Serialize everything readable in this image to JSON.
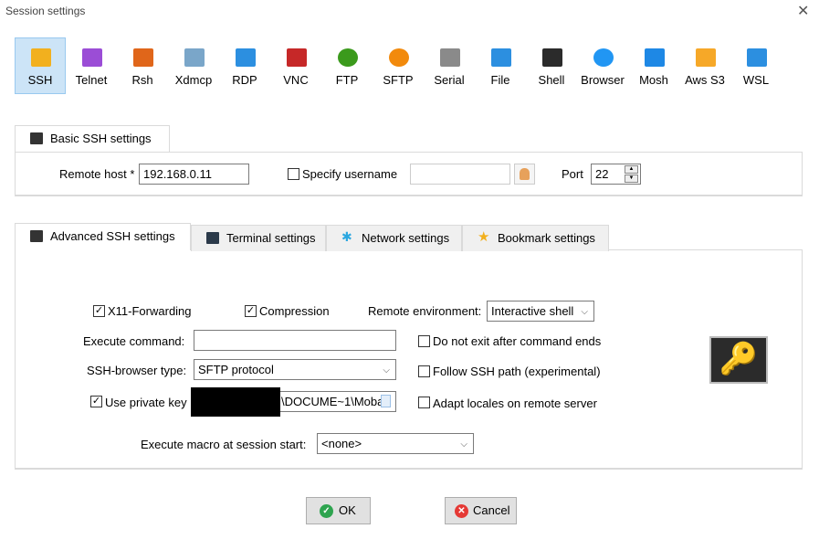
{
  "window": {
    "title": "Session settings",
    "close_icon": "close-icon"
  },
  "session_types": [
    {
      "label": "SSH",
      "icon": "ssh-key-icon",
      "color": "#f2b01e",
      "selected": true
    },
    {
      "label": "Telnet",
      "icon": "telnet-icon",
      "color": "#9b4dd6"
    },
    {
      "label": "Rsh",
      "icon": "rsh-icon",
      "color": "#e0661a"
    },
    {
      "label": "Xdmcp",
      "icon": "xdmcp-icon",
      "color": "#7aa6c9"
    },
    {
      "label": "RDP",
      "icon": "rdp-icon",
      "color": "#2c8fe0"
    },
    {
      "label": "VNC",
      "icon": "vnc-icon",
      "color": "#c62828"
    },
    {
      "label": "FTP",
      "icon": "ftp-globe-icon",
      "color": "#3b9a1c"
    },
    {
      "label": "SFTP",
      "icon": "sftp-globe-icon",
      "color": "#f28a0c"
    },
    {
      "label": "Serial",
      "icon": "serial-plug-icon",
      "color": "#8a8a8a"
    },
    {
      "label": "File",
      "icon": "file-monitor-icon",
      "color": "#2c8fe0"
    },
    {
      "label": "Shell",
      "icon": "shell-terminal-icon",
      "color": "#2b2b2b"
    },
    {
      "label": "Browser",
      "icon": "browser-globe-icon",
      "color": "#2196f3"
    },
    {
      "label": "Mosh",
      "icon": "mosh-satellite-icon",
      "color": "#1e88e5"
    },
    {
      "label": "Aws S3",
      "icon": "aws-s3-icon",
      "color": "#f6a828"
    },
    {
      "label": "WSL",
      "icon": "wsl-windows-icon",
      "color": "#2c8fe0"
    }
  ],
  "basic": {
    "tab_label": "Basic SSH settings",
    "remote_host_label": "Remote host *",
    "remote_host_value": "192.168.0.11",
    "specify_username_label": "Specify username",
    "specify_username_checked": false,
    "username_value": "",
    "port_label": "Port",
    "port_value": "22"
  },
  "advanced_tabs": [
    {
      "label": "Advanced SSH settings",
      "icon": "key-icon",
      "active": true
    },
    {
      "label": "Terminal settings",
      "icon": "terminal-gear-icon"
    },
    {
      "label": "Network settings",
      "icon": "network-icon"
    },
    {
      "label": "Bookmark settings",
      "icon": "star-icon"
    }
  ],
  "advanced": {
    "x11_label": "X11-Forwarding",
    "x11_checked": true,
    "compression_label": "Compression",
    "compression_checked": true,
    "remote_env_label": "Remote environment:",
    "remote_env_value": "Interactive shell",
    "exec_cmd_label": "Execute command:",
    "exec_cmd_value": "",
    "do_not_exit_label": "Do not exit after command ends",
    "do_not_exit_checked": false,
    "browser_type_label": "SSH-browser type:",
    "browser_type_value": "SFTP protocol",
    "follow_path_label": "Follow SSH path (experimental)",
    "follow_path_checked": false,
    "private_key_label": "Use private key",
    "private_key_checked": true,
    "private_key_value": "\\DOCUME~1\\Moba",
    "adapt_locales_label": "Adapt locales on remote server",
    "adapt_locales_checked": false,
    "macro_label": "Execute macro at session start:",
    "macro_value": "<none>"
  },
  "buttons": {
    "ok": "OK",
    "cancel": "Cancel"
  },
  "colors": {
    "selected_bg": "#cce4f7",
    "ok_icon": "#2ea44f",
    "cancel_icon": "#e53935",
    "key_gold": "#f2b01e"
  }
}
